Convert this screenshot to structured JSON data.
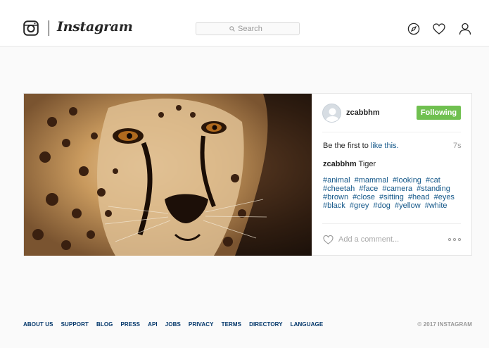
{
  "header": {
    "brand": "Instagram",
    "search_placeholder": "Search"
  },
  "post": {
    "username": "zcabbhm",
    "follow_label": "Following",
    "likes_prefix": "Be the first to ",
    "likes_link": "like this.",
    "time_ago": "7s",
    "caption_user": "zcabbhm",
    "caption_text": " Tiger",
    "hashtags": [
      "#animal",
      "#mammal",
      "#looking",
      "#cat",
      "#cheetah",
      "#face",
      "#camera",
      "#standing",
      "#brown",
      "#close",
      "#sitting",
      "#head",
      "#eyes",
      "#black",
      "#grey",
      "#dog",
      "#yellow",
      "#white"
    ],
    "comment_placeholder": "Add a comment..."
  },
  "footer": {
    "links": [
      "ABOUT US",
      "SUPPORT",
      "BLOG",
      "PRESS",
      "API",
      "JOBS",
      "PRIVACY",
      "TERMS",
      "DIRECTORY",
      "LANGUAGE"
    ],
    "copyright": "© 2017 INSTAGRAM"
  },
  "colors": {
    "follow_green": "#70c050",
    "link_blue": "#125688",
    "footer_link": "#003569"
  },
  "icons": [
    "instagram-camera-icon",
    "search-icon",
    "compass-icon",
    "heart-icon",
    "user-icon",
    "comment-heart-icon",
    "more-options-icon"
  ]
}
